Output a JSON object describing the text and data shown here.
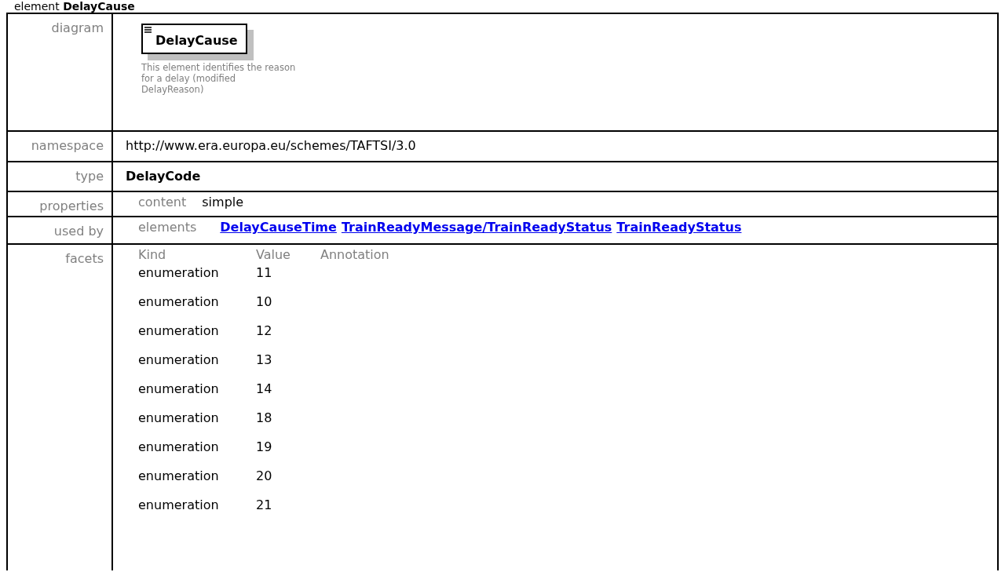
{
  "heading": "element **DelayCause**",
  "rows": [
    {
      "kind": "diagram",
      "label": "diagram",
      "element_name": "DelayCause",
      "description": "This element identifies the reason for a delay (modified DelayReason)"
    },
    {
      "kind": "text",
      "label": "namespace",
      "value": "http://www.era.europa.eu/schemes/TAFTSI/3.0",
      "bold": false
    },
    {
      "kind": "text",
      "label": "type",
      "value": "DelayCode",
      "bold": true
    },
    {
      "kind": "pairs",
      "label": "properties",
      "key": "content",
      "values": [
        "simple"
      ],
      "links": false
    },
    {
      "kind": "pairs",
      "label": "used by",
      "key": "elements",
      "values": [
        "DelayCauseTime",
        "TrainReadyMessage/TrainReadyStatus",
        "TrainReadyStatus"
      ],
      "links": true
    },
    {
      "kind": "facets",
      "label": "facets",
      "columns": [
        "Kind",
        "Value",
        "Annotation"
      ],
      "items": [
        {
          "kind": "enumeration",
          "value": "11"
        },
        {
          "kind": "enumeration",
          "value": "10"
        },
        {
          "kind": "enumeration",
          "value": "12"
        },
        {
          "kind": "enumeration",
          "value": "13"
        },
        {
          "kind": "enumeration",
          "value": "14"
        },
        {
          "kind": "enumeration",
          "value": "18"
        },
        {
          "kind": "enumeration",
          "value": "19"
        },
        {
          "kind": "enumeration",
          "value": "20"
        },
        {
          "kind": "enumeration",
          "value": "21"
        }
      ]
    }
  ]
}
